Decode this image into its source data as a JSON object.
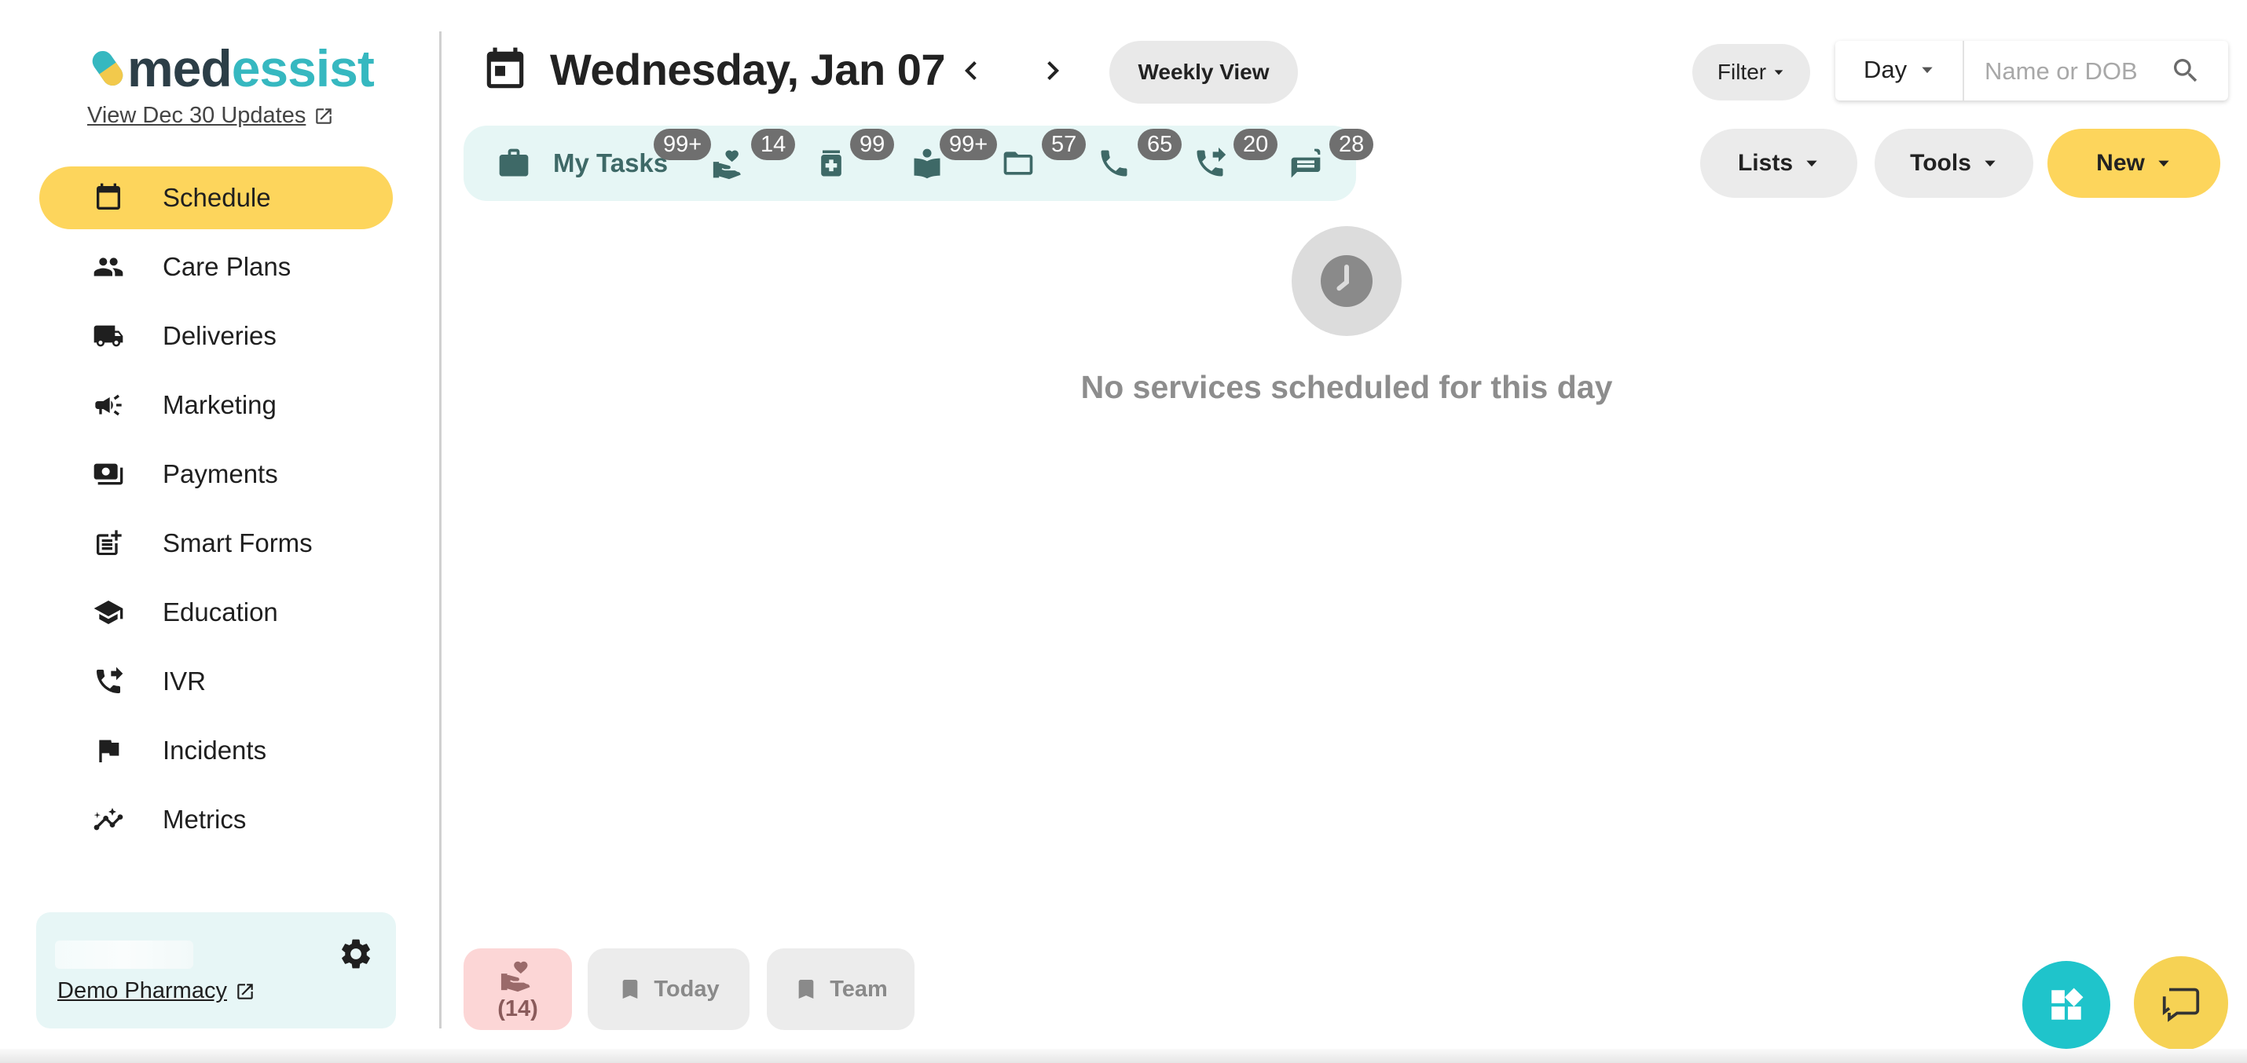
{
  "logo": {
    "part1": "med",
    "part2": "essist"
  },
  "updates_link": "View Dec 30 Updates",
  "sidebar": {
    "items": [
      {
        "label": "Schedule",
        "icon": "calendar-icon",
        "active": true
      },
      {
        "label": "Care Plans",
        "icon": "people-icon"
      },
      {
        "label": "Deliveries",
        "icon": "truck-icon"
      },
      {
        "label": "Marketing",
        "icon": "megaphone-icon"
      },
      {
        "label": "Payments",
        "icon": "payments-icon"
      },
      {
        "label": "Smart Forms",
        "icon": "post-add-icon"
      },
      {
        "label": "Education",
        "icon": "school-icon"
      },
      {
        "label": "IVR",
        "icon": "phone-forward-icon"
      },
      {
        "label": "Incidents",
        "icon": "flag-icon"
      },
      {
        "label": "Metrics",
        "icon": "insights-icon"
      }
    ]
  },
  "pharmacy": {
    "name": "Demo Pharmacy"
  },
  "header": {
    "date": "Wednesday, Jan 07",
    "weekly_view": "Weekly View",
    "filter": "Filter",
    "view_mode": "Day",
    "search_placeholder": "Name or DOB"
  },
  "taskbar": {
    "my_tasks_label": "My Tasks",
    "badges": {
      "my_tasks": "99+",
      "care": "14",
      "medication": "99",
      "education": "99+",
      "folder": "57",
      "phone": "65",
      "phone_forward": "20",
      "messages": "28"
    }
  },
  "actions": {
    "lists": "Lists",
    "tools": "Tools",
    "new": "New"
  },
  "empty_state": {
    "message": "No services scheduled for this day"
  },
  "bottom": {
    "care_count": "(14)",
    "today": "Today",
    "team": "Team"
  },
  "colors": {
    "accent": "#fdd55c",
    "teal": "#1fc4cb",
    "taskbar_bg": "#e6f6f5",
    "taskbar_icon": "#3e6967"
  }
}
